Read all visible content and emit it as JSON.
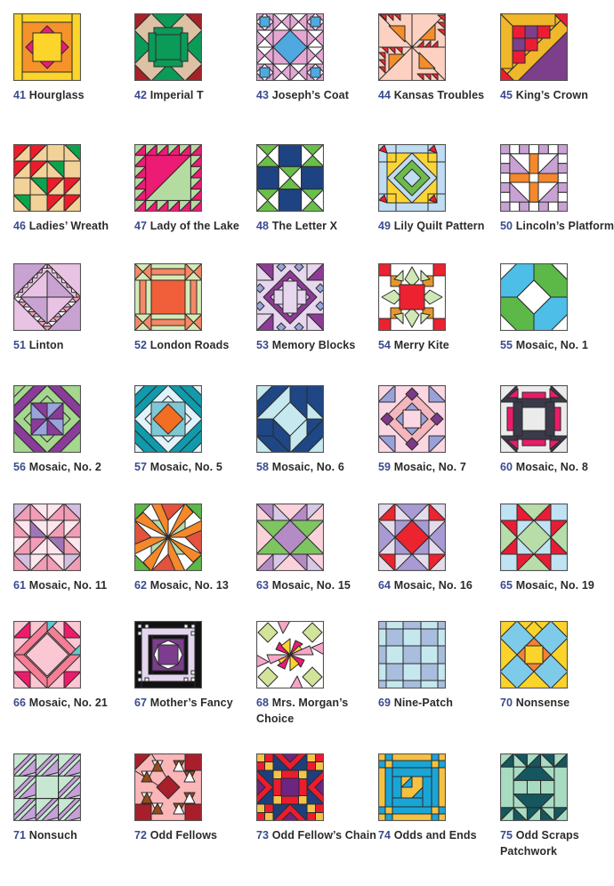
{
  "colors": {
    "number": "#3a4a8f",
    "name": "#2b2b2b",
    "outline": "#2a2a2a"
  },
  "blocks": [
    {
      "number": "41",
      "name": "Hourglass",
      "colors": [
        "#fdd42a",
        "#f5922a",
        "#ec1c74"
      ]
    },
    {
      "number": "42",
      "name": "Imperial T",
      "colors": [
        "#a52226",
        "#0c9a58",
        "#dcc1a4"
      ]
    },
    {
      "number": "43",
      "name": "Joseph’s Coat",
      "colors": [
        "#e4a7d4",
        "#4fa9e0",
        "#ffffff"
      ]
    },
    {
      "number": "44",
      "name": "Kansas Troubles",
      "colors": [
        "#fcd1c1",
        "#f0252d",
        "#f58d2a"
      ]
    },
    {
      "number": "45",
      "name": "King’s Crown",
      "colors": [
        "#f1b72a",
        "#ec1c35",
        "#7d3f8c"
      ]
    },
    {
      "number": "46",
      "name": "Ladies’ Wreath",
      "colors": [
        "#f3d299",
        "#ec1c2a",
        "#0ca44b"
      ]
    },
    {
      "number": "47",
      "name": "Lady of the Lake",
      "colors": [
        "#ec1b74",
        "#b5dca0"
      ]
    },
    {
      "number": "48",
      "name": "The Letter X",
      "colors": [
        "#1e4382",
        "#6abf4b",
        "#ffffff"
      ]
    },
    {
      "number": "49",
      "name": "Lily Quilt Pattern",
      "colors": [
        "#bfdcf2",
        "#fcd535",
        "#6dbb4c",
        "#ec1c2a"
      ]
    },
    {
      "number": "50",
      "name": "Lincoln’s Platform",
      "colors": [
        "#c9a2d4",
        "#f5882a",
        "#ffffff"
      ]
    },
    {
      "number": "51",
      "name": "Linton",
      "colors": [
        "#e9c3e3",
        "#c8a3d2",
        "#f4a0b4",
        "#ffffff"
      ]
    },
    {
      "number": "52",
      "name": "London Roads",
      "colors": [
        "#f58866",
        "#d5ebb6",
        "#f15f3a"
      ]
    },
    {
      "number": "53",
      "name": "Memory Blocks",
      "colors": [
        "#e6d6ee",
        "#8e3b97",
        "#9aa4db"
      ]
    },
    {
      "number": "54",
      "name": "Merry Kite",
      "colors": [
        "#ec2230",
        "#e6962a",
        "#d0e8b5",
        "#ffffff"
      ]
    },
    {
      "number": "55",
      "name": "Mosaic, No. 1",
      "colors": [
        "#4dbee8",
        "#5cb947",
        "#ffffff"
      ]
    },
    {
      "number": "56",
      "name": "Mosaic, No. 2",
      "colors": [
        "#a5d78f",
        "#8a3c9a",
        "#9aa3dc"
      ]
    },
    {
      "number": "57",
      "name": "Mosaic, No. 5",
      "colors": [
        "#e1f3fa",
        "#109aab",
        "#7ec8d6",
        "#f36d22"
      ]
    },
    {
      "number": "58",
      "name": "Mosaic, No. 6",
      "colors": [
        "#c5e9ef",
        "#1f4785"
      ]
    },
    {
      "number": "59",
      "name": "Mosaic, No. 7",
      "colors": [
        "#fbd7e4",
        "#f5b7bc",
        "#7c3a87",
        "#98a2d9"
      ]
    },
    {
      "number": "60",
      "name": "Mosaic, No. 8",
      "colors": [
        "#ebebeb",
        "#3b3a4a",
        "#ec1a6a"
      ]
    },
    {
      "number": "61",
      "name": "Mosaic, No. 11",
      "colors": [
        "#d3bfe0",
        "#f29db6",
        "#fde6ee",
        "#9f75b7"
      ]
    },
    {
      "number": "62",
      "name": "Mosaic, No. 13",
      "colors": [
        "#e2523c",
        "#f5882a",
        "#b4dcae",
        "#5cb947"
      ]
    },
    {
      "number": "63",
      "name": "Mosaic, No. 15",
      "colors": [
        "#fbd2db",
        "#7ec562",
        "#b58bc6",
        "#d8c8e7"
      ]
    },
    {
      "number": "64",
      "name": "Mosaic, No. 16",
      "colors": [
        "#e4dceb",
        "#ec2430",
        "#a89ad2"
      ]
    },
    {
      "number": "65",
      "name": "Mosaic, No. 19",
      "colors": [
        "#bfe3f3",
        "#b8dda8",
        "#e81d35"
      ]
    },
    {
      "number": "66",
      "name": "Mosaic, No. 21",
      "colors": [
        "#fbc7d3",
        "#f57e96",
        "#5ccbd4",
        "#ec1c6a"
      ]
    },
    {
      "number": "67",
      "name": "Mother’s Fancy",
      "colors": [
        "#111111",
        "#e4d6ef",
        "#7c3d8e",
        "#ffffff"
      ]
    },
    {
      "number": "68",
      "name": "Mrs. Morgan’s Choice",
      "colors": [
        "#d2e39a",
        "#ec1c74",
        "#fdd32a",
        "#f6a6c8",
        "#ffffff"
      ]
    },
    {
      "number": "69",
      "name": "Nine-Patch",
      "colors": [
        "#a9bddf",
        "#c4e8ee"
      ]
    },
    {
      "number": "70",
      "name": "Nonsense",
      "colors": [
        "#fcd32a",
        "#7ecbe9",
        "#f48234"
      ]
    },
    {
      "number": "71",
      "name": "Nonsuch",
      "colors": [
        "#c7e7d3",
        "#c6a0d8"
      ]
    },
    {
      "number": "72",
      "name": "Odd Fellows",
      "colors": [
        "#fbb6b8",
        "#a81f2b",
        "#964b1c",
        "#ffffff"
      ]
    },
    {
      "number": "73",
      "name": "Odd Fellow’s Chain",
      "colors": [
        "#1e3f7c",
        "#ec1c2e",
        "#f4c448",
        "#6d2581"
      ]
    },
    {
      "number": "74",
      "name": "Odds and Ends",
      "colors": [
        "#f6c140",
        "#1aa5d7"
      ]
    },
    {
      "number": "75",
      "name": "Odd Scraps Patchwork",
      "colors": [
        "#a8dcc2",
        "#15565f"
      ]
    }
  ]
}
